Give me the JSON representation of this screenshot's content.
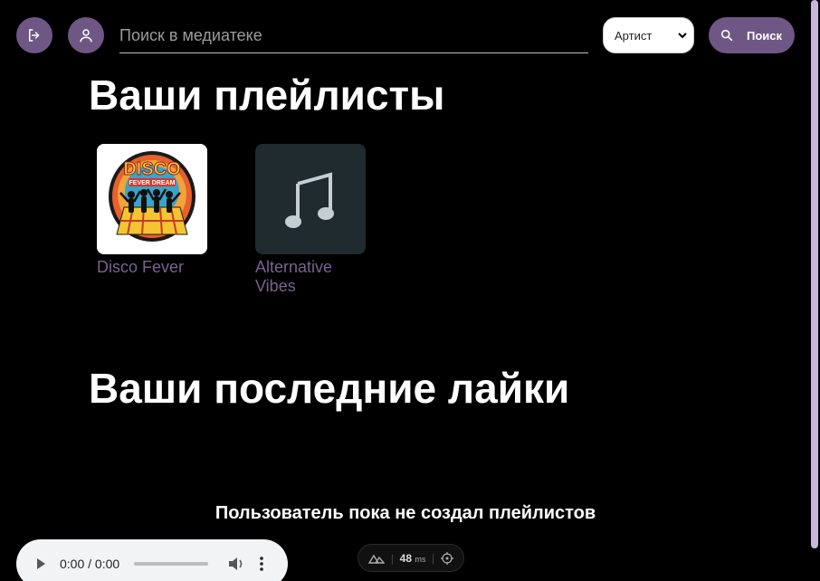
{
  "header": {
    "logout_icon": "logout-icon",
    "profile_icon": "user-icon",
    "search_placeholder": "Поиск в медиатеке",
    "filter_selected": "Артист",
    "search_button_label": "Поиск"
  },
  "playlists_section": {
    "title": "Ваши плейлисты",
    "items": [
      {
        "name": "Disco Fever",
        "cover": "disco-fever-artwork"
      },
      {
        "name": "Alternative Vibes",
        "cover": "music-note-icon"
      }
    ]
  },
  "likes_section": {
    "title": "Ваши последние лайки"
  },
  "empty_message": "Пользователь пока не создал плейлистов",
  "audio_player": {
    "time": "0:00 / 0:00",
    "progress": 0
  },
  "devtools": {
    "latency_value": "48",
    "latency_unit": "ms"
  },
  "colors": {
    "accent": "#6f5785",
    "playlist_title": "#7a618f",
    "scrollbar": "#c9b6dd",
    "background": "#000000"
  }
}
